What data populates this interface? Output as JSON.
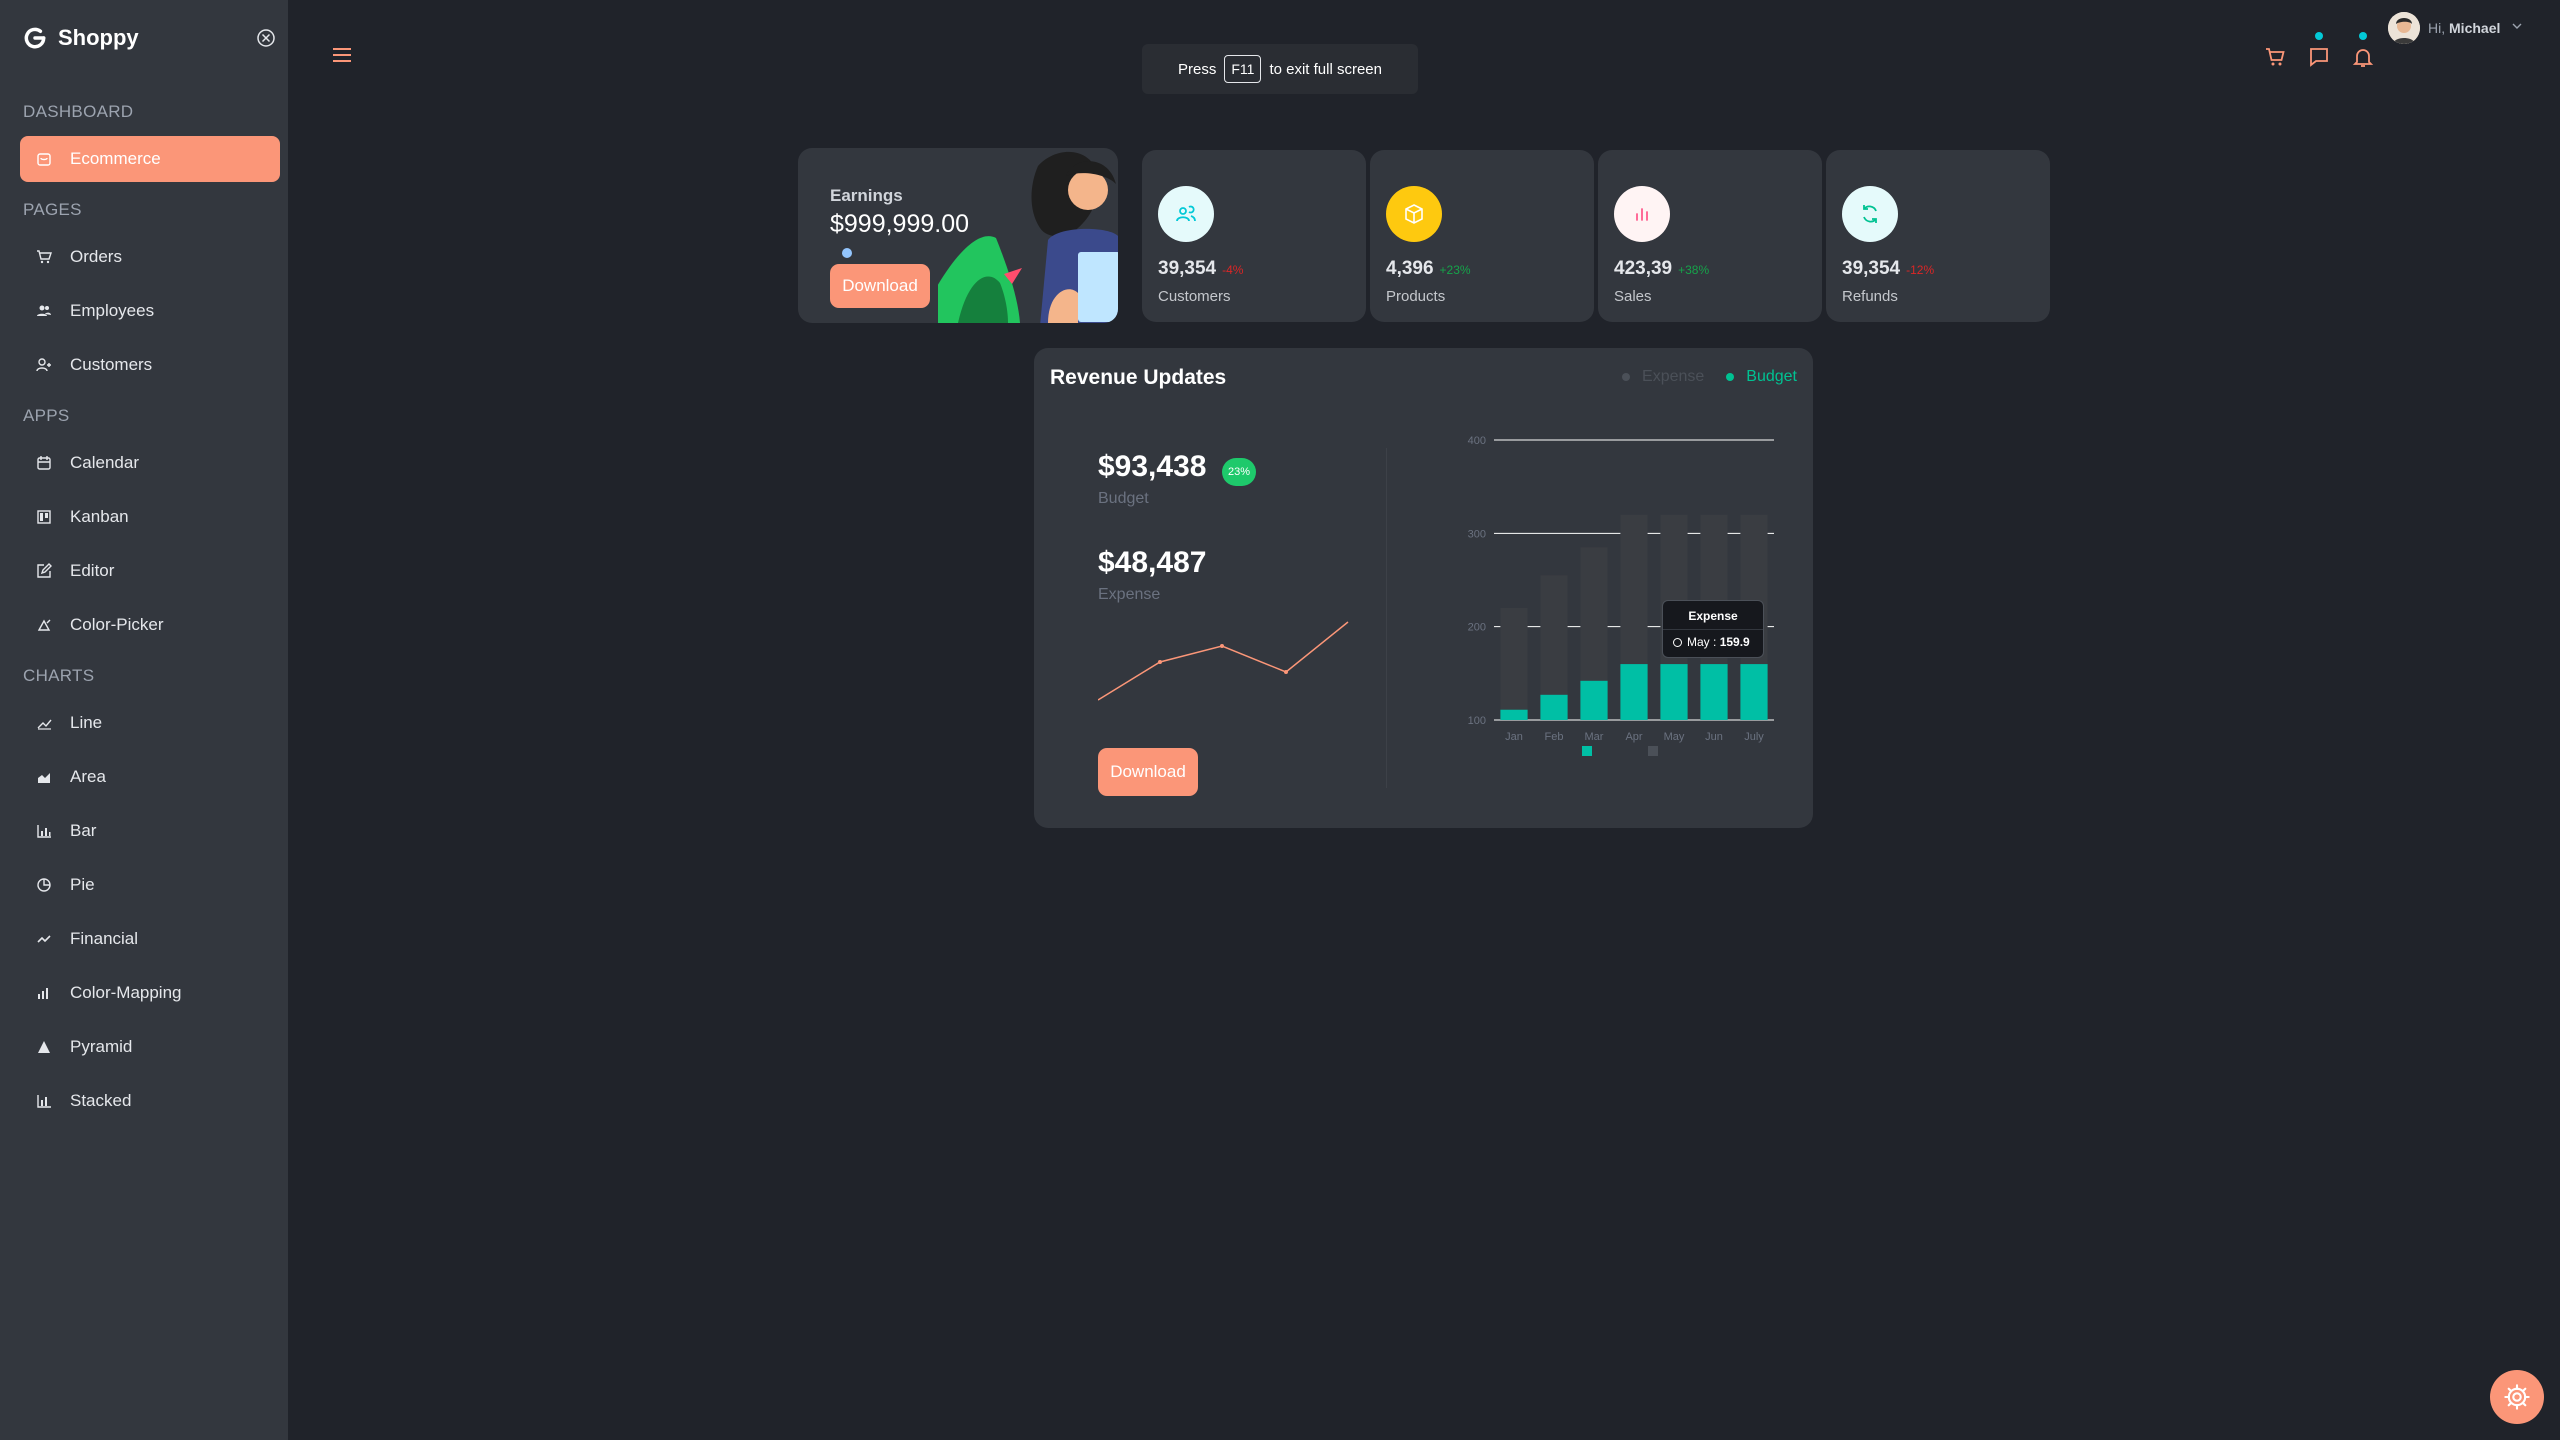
{
  "app": {
    "name": "Shoppy"
  },
  "sidebar": {
    "sections": [
      {
        "title": "DASHBOARD"
      },
      {
        "title": "PAGES"
      },
      {
        "title": "APPS"
      },
      {
        "title": "CHARTS"
      }
    ],
    "items": [
      {
        "label": "Ecommerce",
        "icon": "bag-icon"
      },
      {
        "label": "Orders",
        "icon": "cart-icon"
      },
      {
        "label": "Employees",
        "icon": "people-icon"
      },
      {
        "label": "Customers",
        "icon": "user-icon"
      },
      {
        "label": "Calendar",
        "icon": "calendar-icon"
      },
      {
        "label": "Kanban",
        "icon": "kanban-icon"
      },
      {
        "label": "Editor",
        "icon": "edit-icon"
      },
      {
        "label": "Color-Picker",
        "icon": "color-picker-icon"
      },
      {
        "label": "Line",
        "icon": "line-chart-icon"
      },
      {
        "label": "Area",
        "icon": "area-chart-icon"
      },
      {
        "label": "Bar",
        "icon": "bar-chart-icon"
      },
      {
        "label": "Pie",
        "icon": "pie-chart-icon"
      },
      {
        "label": "Financial",
        "icon": "financial-icon"
      },
      {
        "label": "Color-Mapping",
        "icon": "color-mapping-icon"
      },
      {
        "label": "Pyramid",
        "icon": "pyramid-icon"
      },
      {
        "label": "Stacked",
        "icon": "stacked-icon"
      }
    ]
  },
  "banner": {
    "prefix": "Press",
    "key": "F11",
    "suffix": "to exit full screen"
  },
  "user": {
    "greeting": "Hi,",
    "name": "Michael"
  },
  "earnings": {
    "label": "Earnings",
    "value": "$999,999.00",
    "button": "Download"
  },
  "stats": [
    {
      "value": "39,354",
      "change": "-4%",
      "label": "Customers",
      "icon": "customers-icon",
      "icon_bg": "#E5FAFB",
      "icon_color": "#03C9D7",
      "change_color": "#dc2626"
    },
    {
      "value": "4,396",
      "change": "+23%",
      "label": "Products",
      "icon": "box-icon",
      "icon_bg": "#FEF4E6",
      "icon_color": "#FFFFFF",
      "change_color": "#16a34a"
    },
    {
      "value": "423,39",
      "change": "+38%",
      "label": "Sales",
      "icon": "bar-chart-icon",
      "icon_bg": "#FFF4F4",
      "icon_color": "#FF5C8E",
      "change_color": "#16a34a"
    },
    {
      "value": "39,354",
      "change": "-12%",
      "label": "Refunds",
      "icon": "refresh-icon",
      "icon_bg": "#E5FAFB",
      "icon_color": "#00C292",
      "change_color": "#dc2626"
    }
  ],
  "revenue": {
    "title": "Revenue Updates",
    "legend": [
      {
        "label": "Expense",
        "color": "#4b5058"
      },
      {
        "label": "Budget",
        "color": "#00c292"
      }
    ],
    "budget": {
      "value": "$93,438",
      "badge": "23%",
      "label": "Budget"
    },
    "expense": {
      "value": "$48,487",
      "label": "Expense"
    },
    "button": "Download",
    "tooltip": {
      "title": "Expense",
      "month": "May",
      "value": "159.9"
    }
  },
  "chart_data": {
    "type": "bar",
    "categories": [
      "Jan",
      "Feb",
      "Mar",
      "Apr",
      "May",
      "Jun",
      "July"
    ],
    "series": [
      {
        "name": "Budget",
        "values": [
          111,
          127,
          142,
          159.9,
          159.9,
          159.9,
          159.9
        ],
        "color": "#00bfa5"
      },
      {
        "name": "Expense",
        "values": [
          220,
          255,
          285,
          320,
          320,
          320,
          320
        ],
        "color": "#3a3d42"
      }
    ],
    "y_ticks": [
      100,
      200,
      300,
      400
    ],
    "ylim": [
      100,
      400
    ],
    "grid": true
  },
  "colors": {
    "accent": "#FB9678",
    "teal": "#03C9D7",
    "bg": "#20232A",
    "panel": "#33373E"
  }
}
